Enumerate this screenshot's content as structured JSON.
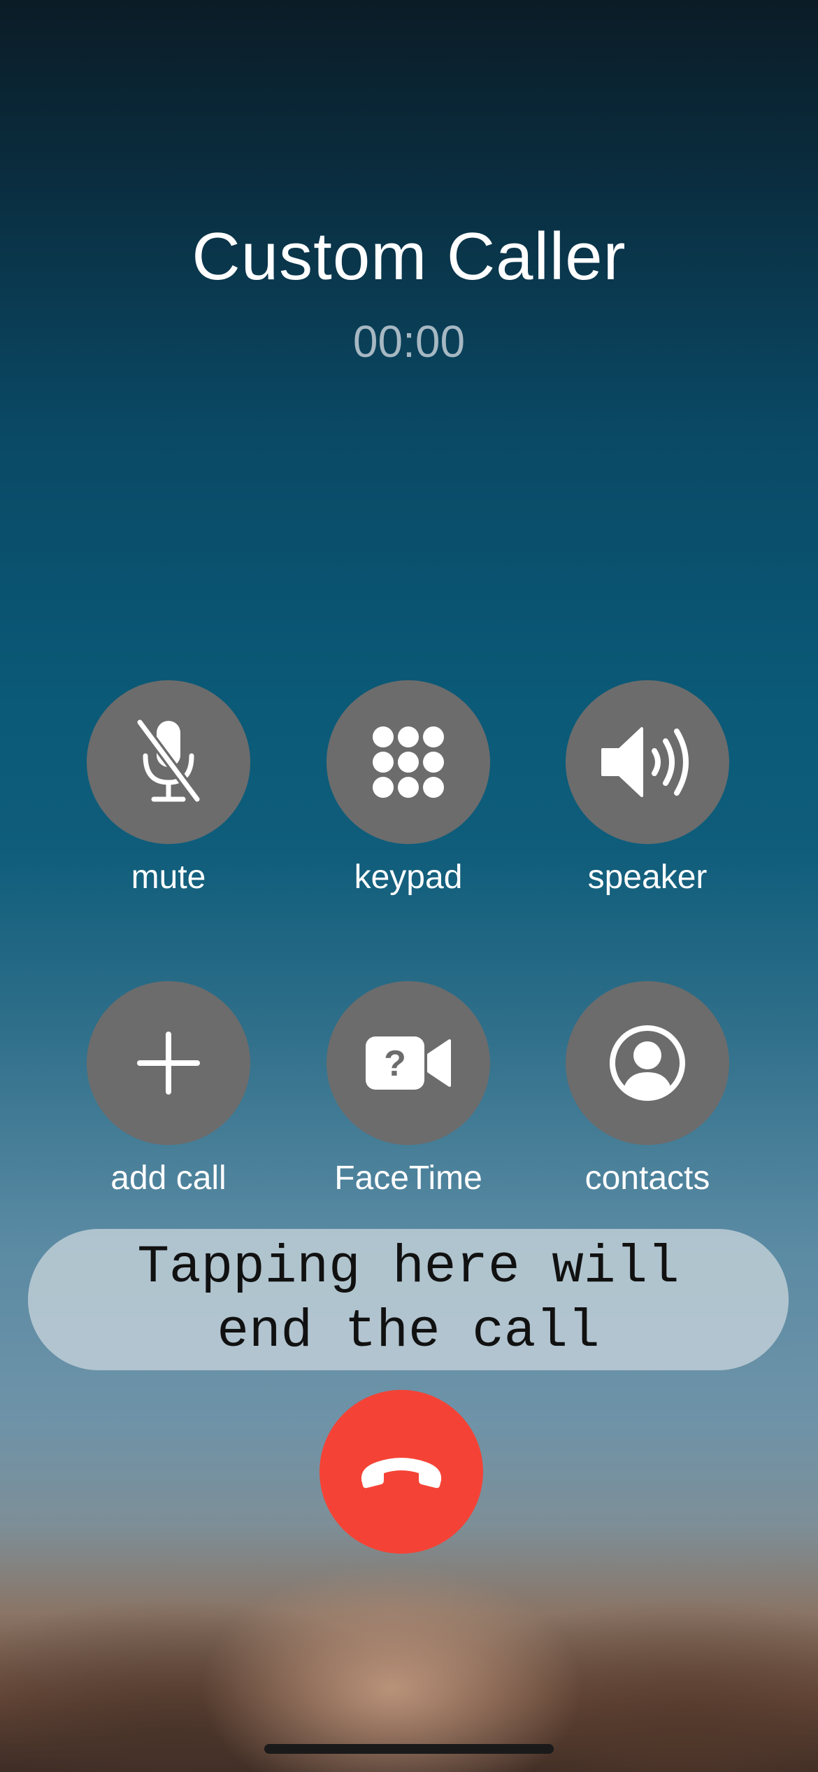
{
  "call": {
    "caller_name": "Custom Caller",
    "timer": "00:00"
  },
  "controls": {
    "mute": {
      "label": "mute",
      "icon": "mic-slash-icon"
    },
    "keypad": {
      "label": "keypad",
      "icon": "keypad-icon"
    },
    "speaker": {
      "label": "speaker",
      "icon": "speaker-icon"
    },
    "add_call": {
      "label": "add call",
      "icon": "plus-icon"
    },
    "facetime": {
      "label": "FaceTime",
      "icon": "video-question-icon"
    },
    "contacts": {
      "label": "contacts",
      "icon": "person-circle-icon"
    }
  },
  "hint": {
    "line1": "Tapping here will",
    "line2": "end the call"
  },
  "end_call": {
    "icon": "phone-down-icon",
    "color": "#f44336"
  },
  "colors": {
    "button_bg": "#6c6c6c",
    "timer": "#a6b8c3"
  }
}
